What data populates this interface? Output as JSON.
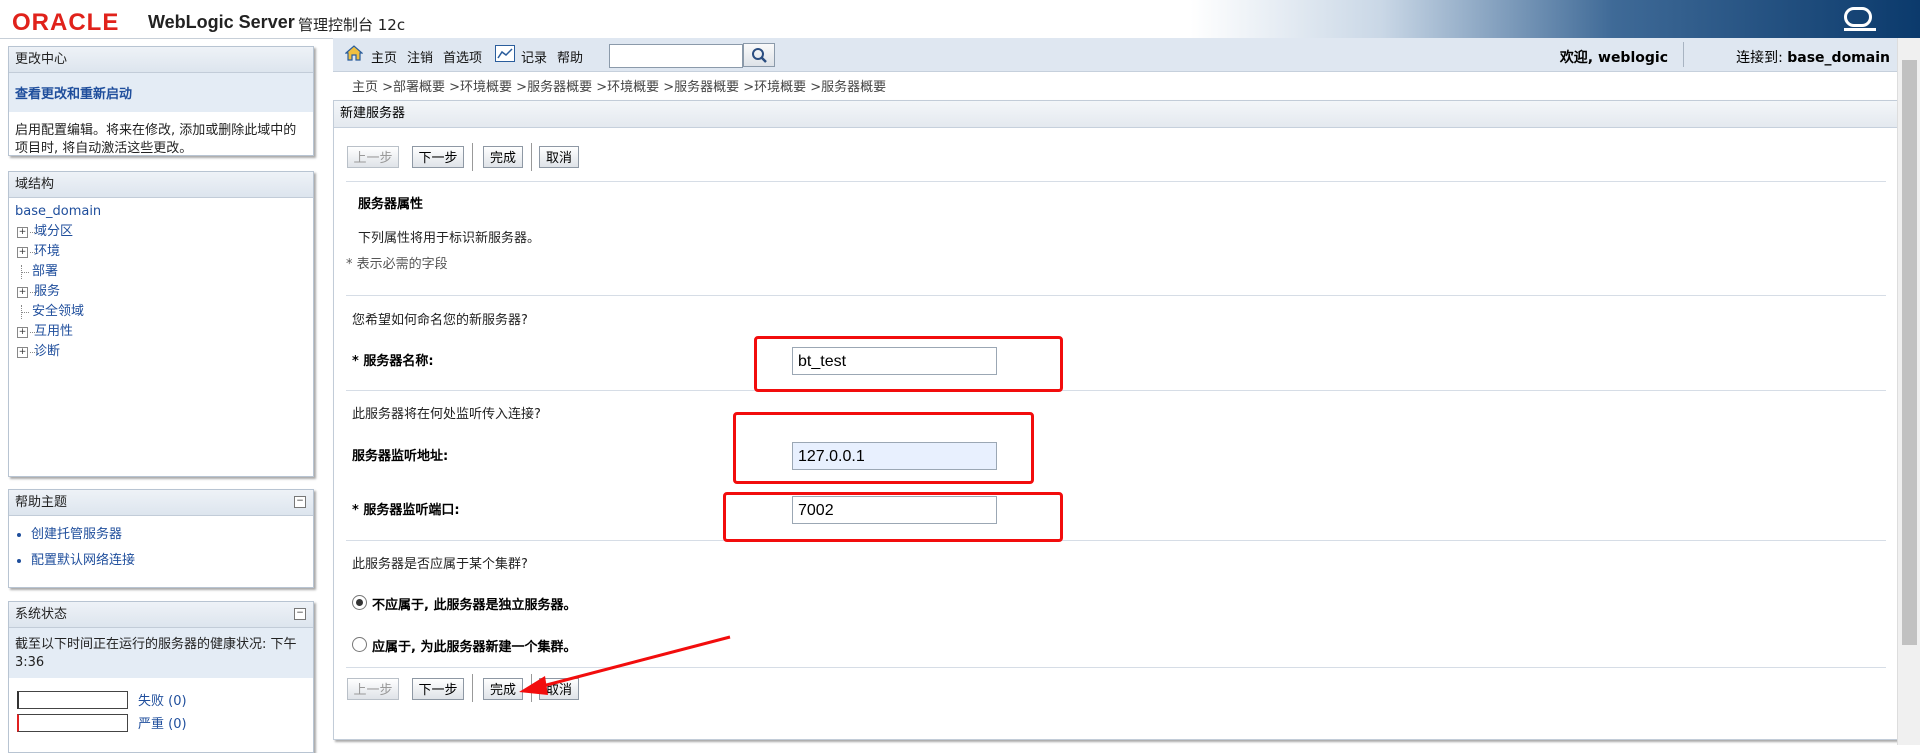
{
  "header": {
    "logo": "ORACLE",
    "product": "WebLogic Server",
    "product_sub": "管理控制台 12c"
  },
  "change_center": {
    "title": "更改中心",
    "link": "查看更改和重新启动",
    "description": "启用配置编辑。将来在修改, 添加或删除此域中的项目时, 将自动激活这些更改。"
  },
  "domain_structure": {
    "title": "域结构",
    "root": "base_domain",
    "items": [
      {
        "label": "域分区",
        "expandable": true
      },
      {
        "label": "环境",
        "expandable": true
      },
      {
        "label": "部署",
        "expandable": false
      },
      {
        "label": "服务",
        "expandable": true
      },
      {
        "label": "安全领域",
        "expandable": false
      },
      {
        "label": "互用性",
        "expandable": true
      },
      {
        "label": "诊断",
        "expandable": true
      }
    ]
  },
  "help_topics": {
    "title": "帮助主题",
    "collapse": "−",
    "items": [
      "创建托管服务器",
      "配置默认网络连接"
    ]
  },
  "system_status": {
    "title": "系统状态",
    "collapse": "−",
    "description": "截至以下时间正在运行的服务器的健康状况: 下午3:36",
    "rows": [
      {
        "label": "失败 (0)",
        "color": "#333333"
      },
      {
        "label": "严重 (0)",
        "color": "#e02020"
      }
    ]
  },
  "toolbar": {
    "home": "主页",
    "logout": "注销",
    "preferences": "首选项",
    "record": "记录",
    "help": "帮助",
    "search_value": "",
    "welcome": "欢迎, weblogic",
    "connected_label": "连接到:",
    "connected_domain": "base_domain"
  },
  "breadcrumb": "主页 >部署概要 >环境概要 >服务器概要 >环境概要 >服务器概要 >环境概要 >服务器概要",
  "main": {
    "title": "新建服务器",
    "buttons": {
      "back": "上一步",
      "next": "下一步",
      "finish": "完成",
      "cancel": "取消"
    },
    "section_title": "服务器属性",
    "intro": "下列属性将用于标识新服务器。",
    "required_note": "* 表示必需的字段",
    "q_name": "您希望如何命名您的新服务器?",
    "name_label": "* 服务器名称:",
    "name_value": "bt_test",
    "q_listen": "此服务器将在何处监听传入连接?",
    "addr_label": "服务器监听地址:",
    "addr_value": "127.0.0.1",
    "port_label": "* 服务器监听端口:",
    "port_value": "7002",
    "q_cluster": "此服务器是否应属于某个集群?",
    "radio_standalone": "不应属于, 此服务器是独立服务器。",
    "radio_cluster": "应属于, 为此服务器新建一个集群。"
  },
  "colors": {
    "annotation_red": "#f20d0d",
    "link_blue": "#1f4e9c",
    "oracle_red": "#e0221b"
  }
}
